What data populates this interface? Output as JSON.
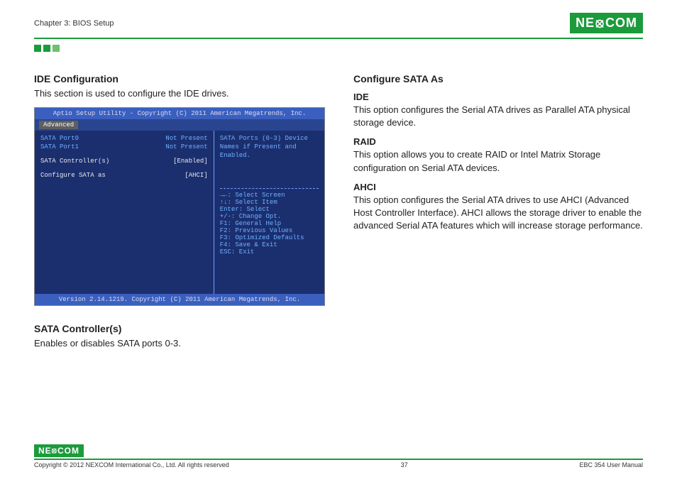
{
  "header": {
    "chapter": "Chapter 3: BIOS Setup",
    "logo_text": "NE COM",
    "logo_x": "X"
  },
  "left": {
    "h1": "IDE Configuration",
    "p1": "This section is used to configure the IDE drives.",
    "h2": "SATA Controller(s)",
    "p2": "Enables or disables SATA ports 0-3."
  },
  "right": {
    "h1": "Configure SATA As",
    "ide_h": "IDE",
    "ide_p": "This option configures the Serial ATA drives as Parallel ATA physical storage device.",
    "raid_h": "RAID",
    "raid_p": "This option allows you to create RAID or Intel Matrix Storage configuration on Serial ATA devices.",
    "ahci_h": "AHCI",
    "ahci_p": "This option configures the Serial ATA drives to use AHCI (Advanced Host Controller Interface). AHCI allows the storage driver to enable the advanced Serial ATA features which will increase storage performance."
  },
  "bios": {
    "title": "Aptio Setup Utility - Copyright (C) 2011 American Megatrends, Inc.",
    "tab": "Advanced",
    "rows": [
      {
        "k": "SATA Port0",
        "v": "Not Present"
      },
      {
        "k": "SATA Port1",
        "v": "Not Present"
      }
    ],
    "rows_white": [
      {
        "k": "SATA Controller(s)",
        "v": "[Enabled]"
      },
      {
        "k": "Configure SATA as",
        "v": "[AHCI]"
      }
    ],
    "help_top": "SATA Ports (0-3) Device Names if Present and Enabled.",
    "help_keys": [
      "→←: Select Screen",
      "↑↓: Select Item",
      "Enter: Select",
      "+/-: Change Opt.",
      "F1: General Help",
      "F2: Previous Values",
      "F3: Optimized Defaults",
      "F4: Save & Exit",
      "ESC: Exit"
    ],
    "footer": "Version 2.14.1219. Copyright (C) 2011 American Megatrends, Inc."
  },
  "footer": {
    "copyright": "Copyright © 2012 NEXCOM International Co., Ltd. All rights reserved",
    "page": "37",
    "manual": "EBC 354 User Manual"
  }
}
